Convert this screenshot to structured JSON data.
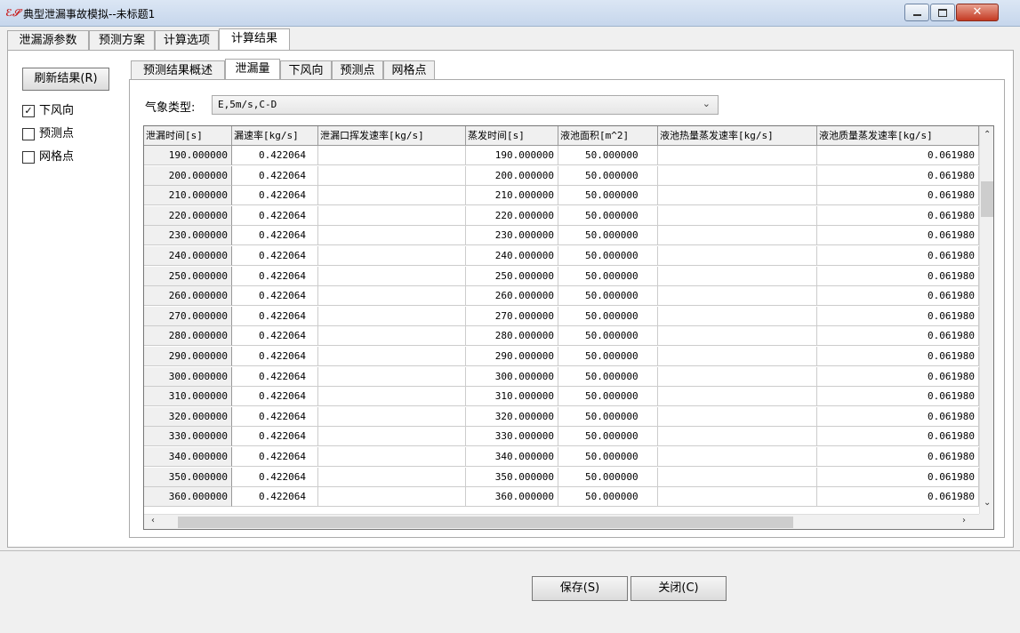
{
  "window": {
    "title": "典型泄漏事故模拟--未标题1",
    "app_icon": "app-logo-icon",
    "controls": {
      "minimize": "minimize-icon",
      "maximize": "maximize-icon",
      "close": "close-icon"
    }
  },
  "main_tabs": [
    "泄漏源参数",
    "预测方案",
    "计算选项",
    "计算结果"
  ],
  "main_tab_active": "计算结果",
  "left": {
    "refresh_label": "刷新结果(R)",
    "checks": [
      {
        "label": "下风向",
        "checked": true,
        "mark": "☑"
      },
      {
        "label": "预测点",
        "checked": false,
        "mark": "☐"
      },
      {
        "label": "网格点",
        "checked": false,
        "mark": "☐"
      }
    ]
  },
  "sub_tabs": [
    "预测结果概述",
    "泄漏量",
    "下风向",
    "预测点",
    "网格点"
  ],
  "sub_tab_active": "泄漏量",
  "meteorology": {
    "label": "气象类型:",
    "value": "E,5m/s,C-D"
  },
  "table": {
    "columns": [
      "泄漏时间[s]",
      "漏速率[kg/s]",
      "泄漏口挥发速率[kg/s]",
      "蒸发时间[s]",
      "液池面积[m^2]",
      "液池热量蒸发速率[kg/s]",
      "液池质量蒸发速率[kg/s]"
    ],
    "rows": [
      [
        "190.000000",
        "0.422064",
        "",
        "190.000000",
        "50.000000",
        "",
        "0.061980"
      ],
      [
        "200.000000",
        "0.422064",
        "",
        "200.000000",
        "50.000000",
        "",
        "0.061980"
      ],
      [
        "210.000000",
        "0.422064",
        "",
        "210.000000",
        "50.000000",
        "",
        "0.061980"
      ],
      [
        "220.000000",
        "0.422064",
        "",
        "220.000000",
        "50.000000",
        "",
        "0.061980"
      ],
      [
        "230.000000",
        "0.422064",
        "",
        "230.000000",
        "50.000000",
        "",
        "0.061980"
      ],
      [
        "240.000000",
        "0.422064",
        "",
        "240.000000",
        "50.000000",
        "",
        "0.061980"
      ],
      [
        "250.000000",
        "0.422064",
        "",
        "250.000000",
        "50.000000",
        "",
        "0.061980"
      ],
      [
        "260.000000",
        "0.422064",
        "",
        "260.000000",
        "50.000000",
        "",
        "0.061980"
      ],
      [
        "270.000000",
        "0.422064",
        "",
        "270.000000",
        "50.000000",
        "",
        "0.061980"
      ],
      [
        "280.000000",
        "0.422064",
        "",
        "280.000000",
        "50.000000",
        "",
        "0.061980"
      ],
      [
        "290.000000",
        "0.422064",
        "",
        "290.000000",
        "50.000000",
        "",
        "0.061980"
      ],
      [
        "300.000000",
        "0.422064",
        "",
        "300.000000",
        "50.000000",
        "",
        "0.061980"
      ],
      [
        "310.000000",
        "0.422064",
        "",
        "310.000000",
        "50.000000",
        "",
        "0.061980"
      ],
      [
        "320.000000",
        "0.422064",
        "",
        "320.000000",
        "50.000000",
        "",
        "0.061980"
      ],
      [
        "330.000000",
        "0.422064",
        "",
        "330.000000",
        "50.000000",
        "",
        "0.061980"
      ],
      [
        "340.000000",
        "0.422064",
        "",
        "340.000000",
        "50.000000",
        "",
        "0.061980"
      ],
      [
        "350.000000",
        "0.422064",
        "",
        "350.000000",
        "50.000000",
        "",
        "0.061980"
      ],
      [
        "360.000000",
        "0.422064",
        "",
        "360.000000",
        "50.000000",
        "",
        "0.061980"
      ]
    ]
  },
  "buttons": {
    "save": "保存(S)",
    "close": "关闭(C)"
  }
}
